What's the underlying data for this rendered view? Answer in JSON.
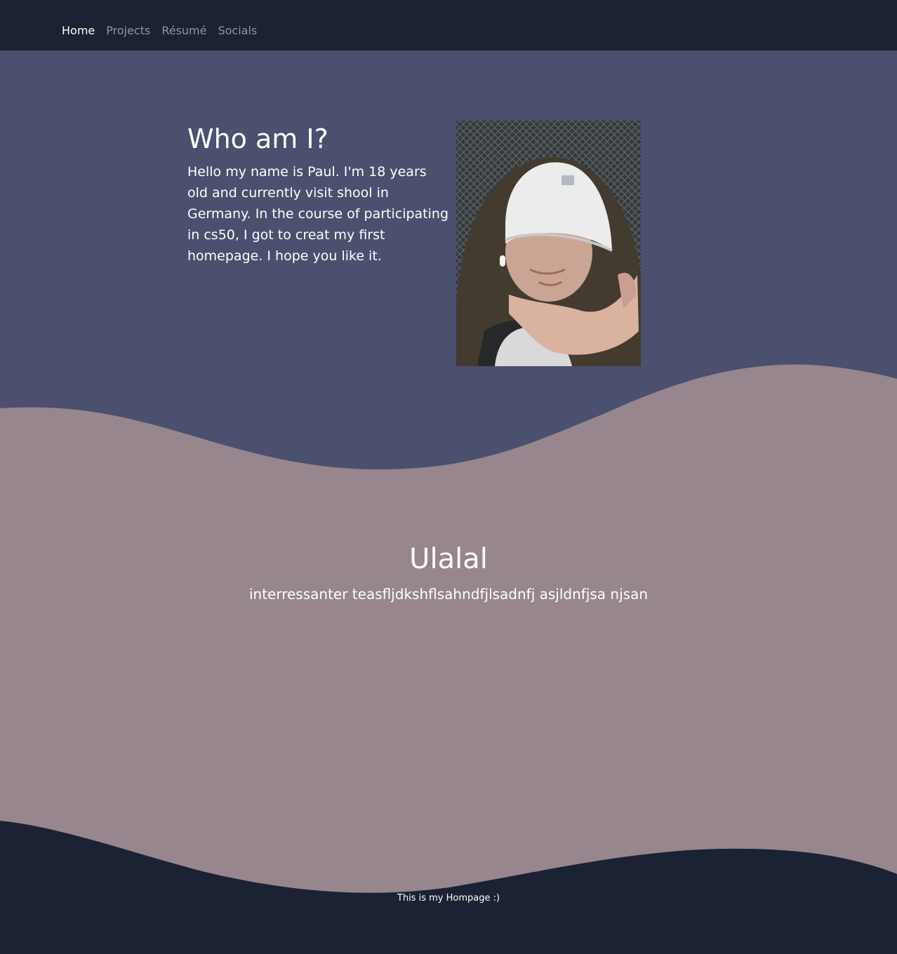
{
  "nav": {
    "items": [
      {
        "label": "Home",
        "active": true
      },
      {
        "label": "Projects",
        "active": false
      },
      {
        "label": "Résumé",
        "active": false
      },
      {
        "label": "Socials",
        "active": false
      }
    ]
  },
  "intro": {
    "title": "Who am I?",
    "text": "Hello my name is Paul. I'm 18 years old and currently visit shool in Germany. In the course of participating in cs50, I got to creat my first homepage. I hope you like it."
  },
  "section2": {
    "title": "Ulalal",
    "text": "interressanter teasfljdkshflsahndfjlsadnfj asjldnfjsa njsan"
  },
  "footer": {
    "text": "This is my Hompage :)"
  },
  "colors": {
    "navbar": "#1a2233",
    "hero": "#4a506e",
    "wave_section": "#97868d",
    "footer": "#1a2233",
    "text": "#ffffff",
    "nav_inactive": "#8f96a5"
  }
}
